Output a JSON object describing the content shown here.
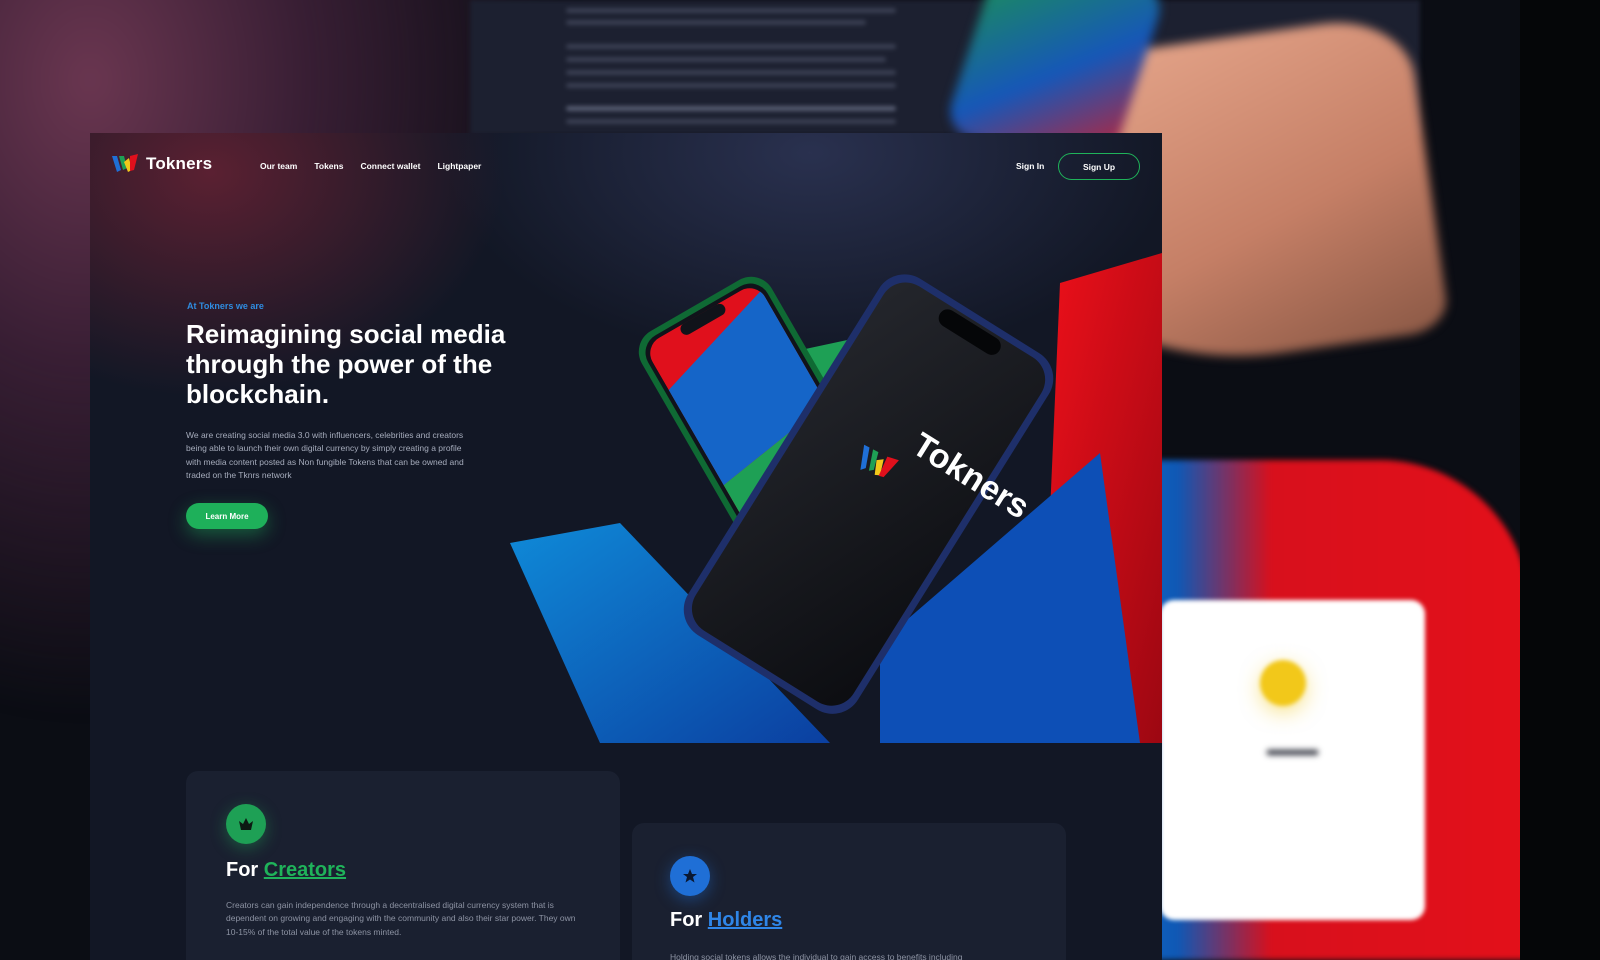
{
  "brand": {
    "name": "Tokners"
  },
  "nav": {
    "items": [
      "Our team",
      "Tokens",
      "Connect wallet",
      "Lightpaper"
    ],
    "sign_in": "Sign In",
    "sign_up": "Sign Up"
  },
  "hero": {
    "eyebrow": "At Tokners we are",
    "headline": "Reimagining social media through the power of the blockchain.",
    "body": "We are creating social media 3.0 with influencers, celebrities and creators being able to launch their own digital currency by simply creating a profile with media content posted as Non fungible Tokens that can be owned and traded on the Tknrs network",
    "cta": "Learn More",
    "phone_brand": "Tokners"
  },
  "features": [
    {
      "title_prefix": "For",
      "title_highlight": "Creators",
      "body": "Creators can gain independence through a decentralised digital currency system that is  dependent on growing and engaging with the community and also their star power. They own  10-15% of the total value of the tokens minted.",
      "icon": "crown-icon"
    },
    {
      "title_prefix": "For",
      "title_highlight": "Holders",
      "body": "Holding social tokens allows the individual to gain access to benefits including",
      "icon": "star-icon"
    }
  ],
  "colors": {
    "green": "#1fb35a",
    "blue": "#2f86e8",
    "red": "#e0101c",
    "yellow": "#f2c81a",
    "page_bg": "#121725"
  }
}
